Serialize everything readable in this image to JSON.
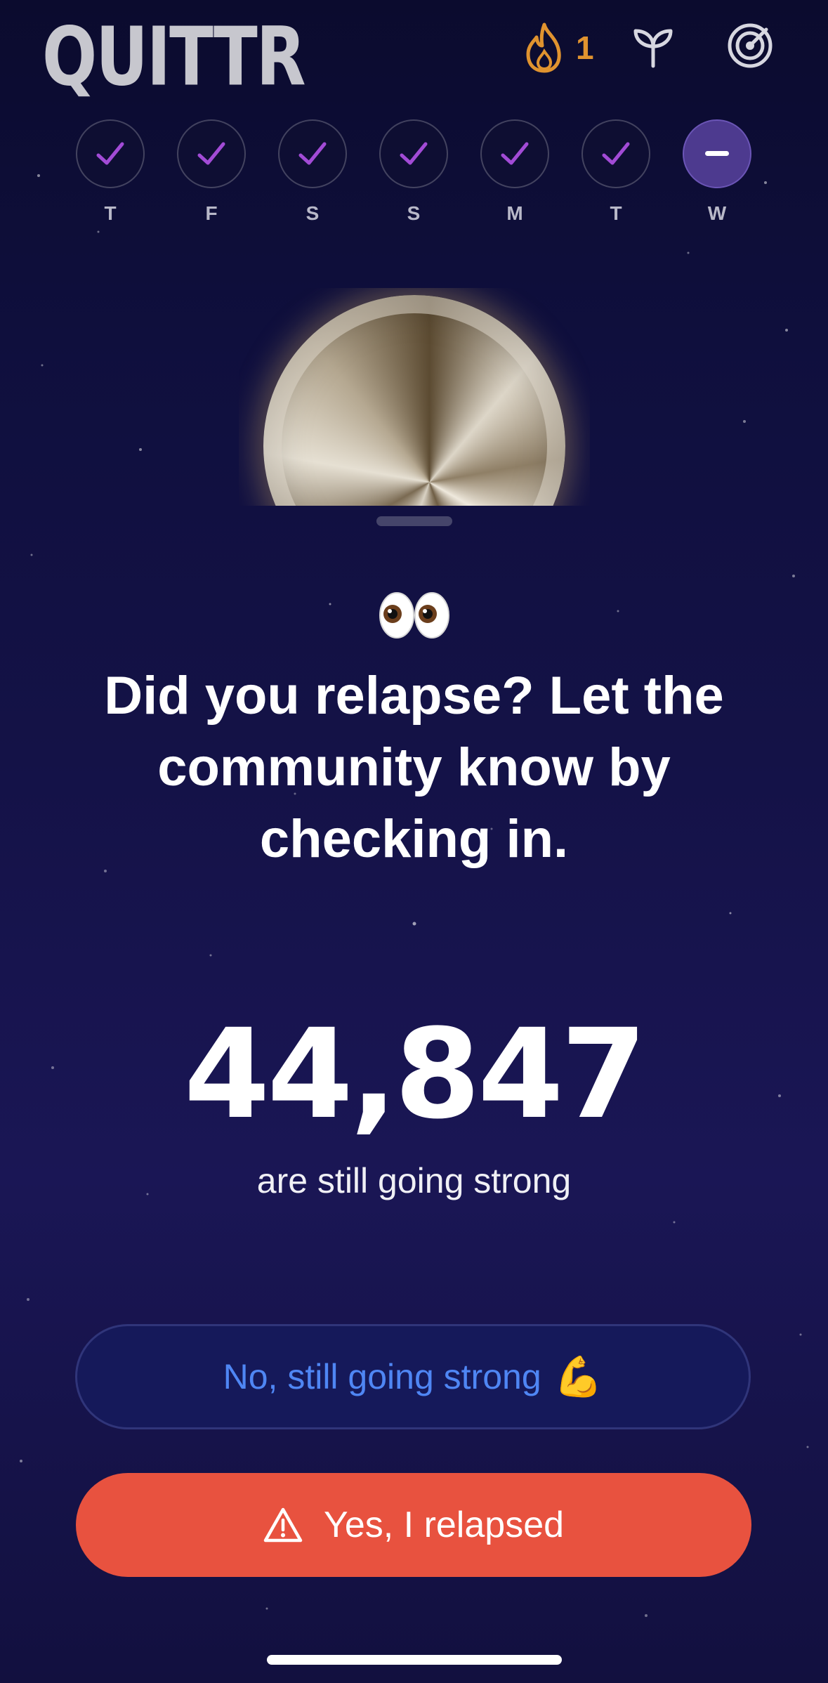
{
  "app": {
    "logo_text": "QUITTR"
  },
  "header": {
    "streak_count": "1",
    "streak_icon": "flame-icon",
    "sprout_icon": "sprout-icon",
    "target_icon": "target-icon"
  },
  "week": {
    "days": [
      {
        "label": "T",
        "status": "checked"
      },
      {
        "label": "F",
        "status": "checked"
      },
      {
        "label": "S",
        "status": "checked"
      },
      {
        "label": "S",
        "status": "checked"
      },
      {
        "label": "M",
        "status": "checked"
      },
      {
        "label": "T",
        "status": "checked"
      },
      {
        "label": "W",
        "status": "pending"
      }
    ]
  },
  "checkin": {
    "emoji": "👀",
    "headline": "Did you relapse? Let the community know by checking in.",
    "community_count": "44,847",
    "count_caption": "are still going strong",
    "no_button_label": "No, still going strong",
    "no_button_emoji": "💪",
    "yes_button_label": "Yes, I relapsed"
  },
  "colors": {
    "accent_purple": "#a24bd6",
    "streak_orange": "#e0932f",
    "no_button_text": "#4f86f4",
    "yes_button_bg": "#e8523f"
  }
}
